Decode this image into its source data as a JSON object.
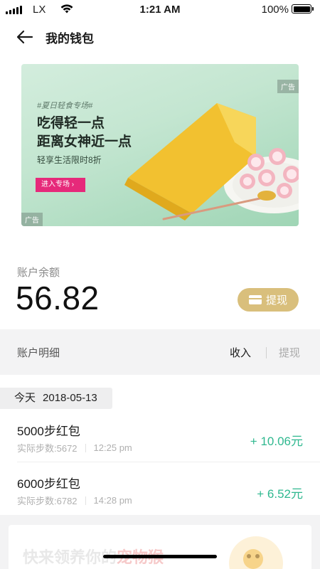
{
  "status_bar": {
    "carrier": "LX",
    "time": "1:21 AM",
    "battery_percent": "100%",
    "battery_level": 1.0
  },
  "nav": {
    "title": "我的钱包"
  },
  "banner": {
    "tag": "#夏日轻食专场#",
    "headline_1": "吃得轻一点",
    "headline_2": "距离女神近一点",
    "subtitle": "轻享生活限时8折",
    "cta": "进入专场 ›",
    "ad_label": "广告",
    "ad_label_2": "广告"
  },
  "balance": {
    "label": "账户余额",
    "value": "56.82",
    "withdraw_label": "提现"
  },
  "details": {
    "title": "账户明细",
    "tab_income": "收入",
    "tab_withdraw": "提现"
  },
  "date_group": {
    "day": "今天",
    "date": "2018-05-13"
  },
  "records": [
    {
      "title": "5000步红包",
      "steps": "实际步数:5672",
      "time": "12:25 pm",
      "amount": "+ 10.06元"
    },
    {
      "title": "6000步红包",
      "steps": "实际步数:6782",
      "time": "14:28 pm",
      "amount": "+ 6.52元"
    }
  ],
  "promo": {
    "text_prefix": "快来领养你的",
    "text_highlight": "宠物猴"
  },
  "colors": {
    "accent_gold": "#d9bf7c",
    "income_green": "#2fb88f",
    "cta_pink": "#e6297a"
  }
}
